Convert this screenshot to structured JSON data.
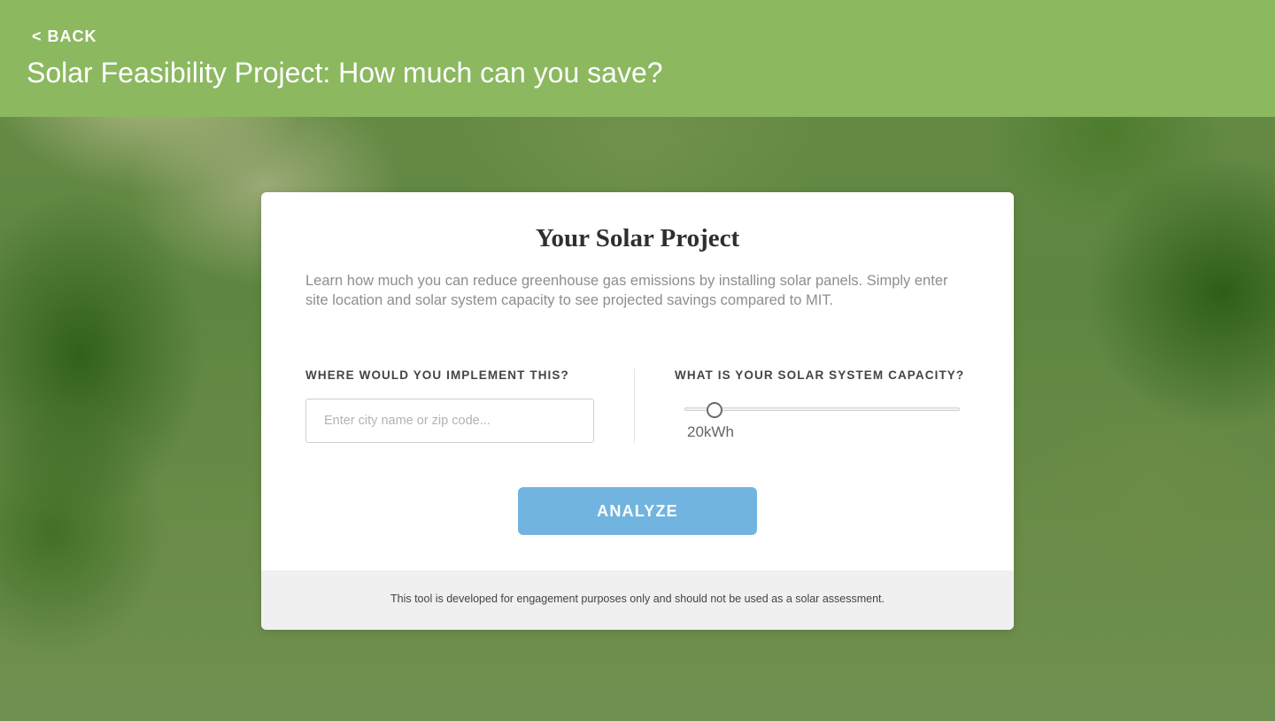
{
  "header": {
    "back_label": "< BACK",
    "title": "Solar Feasibility Project: How much can you save?",
    "background_color": "#8cb860"
  },
  "card": {
    "title": "Your Solar Project",
    "description": "Learn how much you can reduce greenhouse gas emissions by installing solar panels. Simply enter site location and solar system capacity to see projected savings compared to MIT.",
    "location": {
      "label": "WHERE WOULD YOU IMPLEMENT THIS?",
      "placeholder": "Enter city name or zip code...",
      "value": ""
    },
    "capacity": {
      "label": "WHAT IS YOUR SOLAR SYSTEM CAPACITY?",
      "value_text": "20kWh",
      "slider_fraction": 0.11
    },
    "analyze_label": "ANALYZE",
    "analyze_color": "#72b4e0",
    "disclaimer": "This tool is developed for engagement purposes only and should not be used as a solar assessment."
  }
}
